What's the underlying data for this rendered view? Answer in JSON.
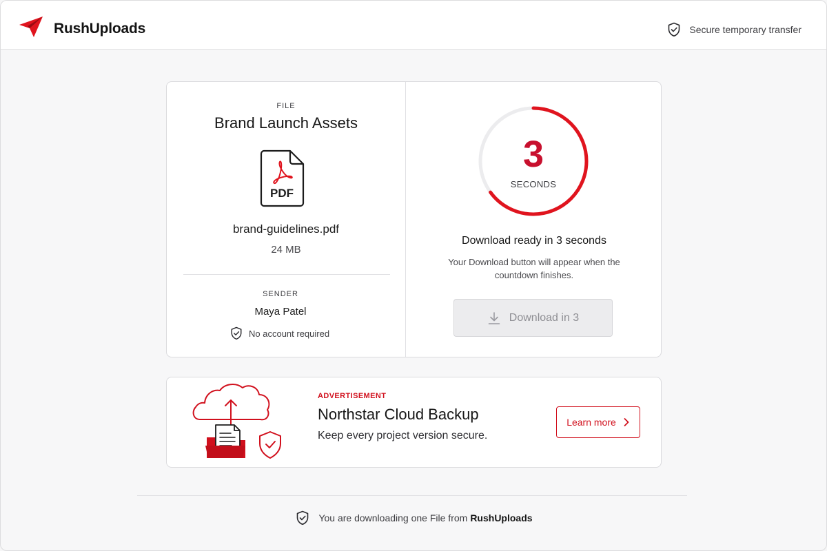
{
  "header": {
    "brand": "RushUploads",
    "secure_text": "Secure temporary transfer"
  },
  "file": {
    "label": "FILE",
    "title": "Brand Launch Assets",
    "icon_text": "PDF",
    "name": "brand-guidelines.pdf",
    "size": "24 MB"
  },
  "sender": {
    "label": "SENDER",
    "name": "Maya Patel",
    "no_account": "No account required"
  },
  "countdown": {
    "seconds": "3",
    "unit": "SECONDS",
    "progress": 0.65,
    "title": "Download ready in 3 seconds",
    "desc": "Your Download button will appear when the countdown finishes.",
    "button_label": "Download in 3"
  },
  "ad": {
    "tag": "ADVERTISEMENT",
    "title": "Northstar Cloud Backup",
    "subtitle": "Keep every project version secure.",
    "cta": "Learn more"
  },
  "footer": {
    "text": "You are downloading one File from",
    "brand": "RushUploads"
  },
  "colors": {
    "accent": "#d1101d",
    "countdown": "#c8102e",
    "disabled_bg": "#ececee"
  },
  "icons": [
    "paper-plane-icon",
    "shield-check-icon",
    "pdf-file-icon",
    "download-icon",
    "cloud-upload-icon",
    "chevron-right-icon"
  ]
}
